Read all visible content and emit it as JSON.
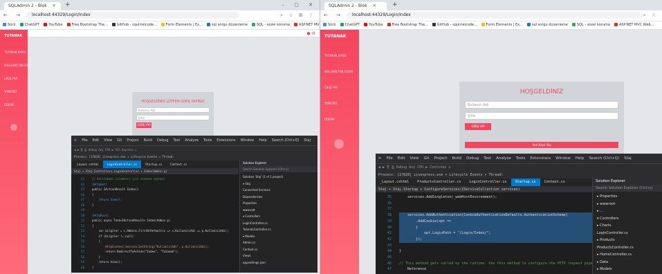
{
  "left": {
    "browser": {
      "tab_title": "SQLAdmin 2 - Blok",
      "new_tab": "+",
      "window_controls": "– ▢ ✕",
      "nav_icons": "← → ⟳ ⌂",
      "url": "localhost:44329/Login/Index",
      "addr_icons": "⌕ ☆ ⊞ ⋮",
      "bookmarks": [
        {
          "label": "Sürü",
          "color": "#4285f4"
        },
        {
          "label": "ChatGPT",
          "color": "#10a37f"
        },
        {
          "label": "YouTube",
          "color": "#ff0000"
        },
        {
          "label": "Free Bootstrap The...",
          "color": "#d93025"
        },
        {
          "label": "GitHub - squirrelcode...",
          "color": "#333333"
        },
        {
          "label": "Form Elements | Ex...",
          "color": "#fbbc04"
        },
        {
          "label": "sql sorgu düzenleme",
          "color": "#1a73e8"
        },
        {
          "label": "SQL - sozel koruma",
          "color": "#34a853"
        },
        {
          "label": "ASP.NET MVC Web...",
          "color": "#d93025"
        }
      ]
    },
    "app": {
      "brand": "TUTANAK",
      "side_items": [
        "TUTANAK KAYDI",
        "KULLANICI BİLGİLERİ",
        "ÇIKIŞ YAP",
        "YÖNETİCİ",
        "ÖDEME"
      ],
      "card_title": "HOŞGELDİNİZ LÜTFEN GİRİŞ YAPINIZ",
      "username_placeholder": "Kullanıcı Adı",
      "password_placeholder": "Şifre",
      "login_button": "GİRİŞ YAP"
    },
    "vs": {
      "menu": [
        "File",
        "Edit",
        "View",
        "Git",
        "Project",
        "Build",
        "Debug",
        "Test",
        "Analyze",
        "Tools",
        "Extensions",
        "Window",
        "Help",
        "Search (Ctrl+Q)",
        "Staj"
      ],
      "tool": "◀ ▶  ⎘ ⎙  Debug  Any CPU  ▶ IIS Express  ↻",
      "process": "Process: [17828] iisexpress.exe   ▾ Lifecycle Events ▾ Thread:",
      "tabs": [
        "_Layout.cshtml",
        "LoginController.cs",
        "Startup.cs",
        "Context.cs"
      ],
      "active_tab": "LoginController.cs",
      "crumb": "Staj   ▾  Staj.Controllers.LoginController   ▾  Index(Admin p)",
      "lines": [
        "43",
        "44",
        "45",
        "46",
        "47",
        "48",
        "49",
        "50",
        "51",
        "52",
        "53",
        "54",
        "55",
        "56",
        "57",
        "58",
        "59",
        "60"
      ],
      "code": [
        {
          "cls": "cm",
          "text": "// Veritabanı işlemleri için context nesnesi"
        },
        {
          "cls": "kw",
          "text": "[HttpGet]"
        },
        {
          "cls": "",
          "text": "public IActionResult Index()"
        },
        {
          "cls": "",
          "text": "{"
        },
        {
          "cls": "kw",
          "text": "    return View();"
        },
        {
          "cls": "",
          "text": "}"
        },
        {
          "cls": "",
          "text": ""
        },
        {
          "cls": "kw",
          "text": "[HttpPost]"
        },
        {
          "cls": "",
          "text": "public async Task<IActionResult> Index(Admin p)"
        },
        {
          "cls": "",
          "text": "{"
        },
        {
          "cls": "",
          "text": "    var bilgiler = c.Admins.FirstOrDefault(x => x.KullaniciAdi == p.KullaniciAdi);"
        },
        {
          "cls": "",
          "text": "    if (bilgiler != null)"
        },
        {
          "cls": "",
          "text": "    {"
        },
        {
          "cls": "st",
          "text": "        HttpContext.Session.SetString(\"KullaniciAdi\", p.KullaniciAdi);"
        },
        {
          "cls": "",
          "text": "        return RedirectToAction(\"Index\", \"Tutanak\");"
        },
        {
          "cls": "",
          "text": "    }"
        },
        {
          "cls": "",
          "text": "    return View();"
        },
        {
          "cls": "",
          "text": "}"
        }
      ],
      "se_title": "Solution Explorer",
      "se_search": "Search Solution Explorer (Ctrl+ş)",
      "se_items": [
        "Solution 'Staj' (1 of 1 project)",
        "▾ Staj",
        "  Connected Services",
        "  Dependencies",
        "  Properties",
        "  wwwroot",
        "  ▾ Controllers",
        "    LoginController.cs",
        "    TutanakController.cs",
        "  ▾ Models",
        "    Admin.cs",
        "    Context.cs",
        "  Views",
        "  appsettings.json"
      ]
    }
  },
  "right": {
    "browser": {
      "tab_title": "SQLAdmin 2 - Blok",
      "new_tab": "+",
      "nav_icons": "← → ⟳ ⌂",
      "url": "localhost:44329/Login/Index",
      "addr_icons": "⌕ ☆",
      "bookmarks": [
        {
          "label": "Sürü",
          "color": "#4285f4"
        },
        {
          "label": "ChatGPT",
          "color": "#10a37f"
        },
        {
          "label": "YouTube",
          "color": "#ff0000"
        },
        {
          "label": "Free Bootstrap The...",
          "color": "#d93025"
        },
        {
          "label": "GitHub - squirrelcode...",
          "color": "#333333"
        },
        {
          "label": "Form Elements | Ex...",
          "color": "#fbbc04"
        },
        {
          "label": "sql sorgu düzenleme",
          "color": "#1a73e8"
        },
        {
          "label": "SQL - sozel koruma",
          "color": "#34a853"
        },
        {
          "label": "ASP.NET MVC Web...",
          "color": "#d93025"
        }
      ]
    },
    "app": {
      "brand": "TUTANAK",
      "side_items": [
        "TUTANAK KAYDI",
        "KULLANICI BİLGİLERİ",
        "ÇIKIŞ YAP",
        "YÖNETİCİ",
        "ÖDEME"
      ],
      "card_title": "HOŞGELDİNİZ",
      "username_placeholder": "Kullanıcı Adı",
      "password_placeholder": "Şifre",
      "login_button": "GİRİŞ YAP",
      "wide_button": "Yeni Kayıt Yap"
    },
    "vs": {
      "menu": [
        "File",
        "Edit",
        "View",
        "Git",
        "Project",
        "Build",
        "Debug",
        "Test",
        "Analyze",
        "Tools",
        "Extensions",
        "Window",
        "Help",
        "Search (Ctrl+Q)",
        "Staj"
      ],
      "tool": "◀ ▶  ⎘ ⎙  Debug  Any CPU  ▶ Continue  ↻",
      "process": "Process: [17828] iisexpress.exe   ▾ Lifecycle Events ▾ Thread:",
      "tabs": [
        "_Layout.cshtml",
        "ProductsController.cs",
        "LoginController.cs",
        "Startup.cs",
        "Context.cs"
      ],
      "active_tab": "Startup.cs",
      "crumb": "Staj   ▾  Staj.Startup   ▾  ConfigureServices(IServiceCollection services)",
      "lines": [
        "35",
        "36",
        "37",
        "38",
        "39",
        "40",
        "41",
        "42",
        "43",
        "44",
        "45",
        "46",
        "47"
      ],
      "code": [
        {
          "cls": "",
          "text": "    services.AddSingleton(_webHostEnvironment);"
        },
        {
          "cls": "",
          "text": ""
        },
        {
          "cls": "",
          "text": ""
        },
        {
          "cls": "sel",
          "text": "    services.AddAuthentication(CookieAuthenticationDefaults.AuthenticationScheme)"
        },
        {
          "cls": "sel",
          "text": "        .AddCookie(opt =>"
        },
        {
          "cls": "sel",
          "text": "        {"
        },
        {
          "cls": "sel",
          "text": "            opt.LoginPath = \"/Login/Index/\";"
        },
        {
          "cls": "sel",
          "text": "        });"
        },
        {
          "cls": "",
          "text": ""
        },
        {
          "cls": "",
          "text": "}"
        },
        {
          "cls": "",
          "text": ""
        },
        {
          "cls": "cm",
          "text": "// This method gets called by the runtime. Use this method to configure the HTTP request pipeline."
        },
        {
          "cls": "",
          "text": "    Reference"
        }
      ],
      "se_title": "Solution Explorer",
      "se_search": "Search Solution Explorer (Ctrl+ş)",
      "se_items": [
        "▸ Properties",
        "▸ wwwroot",
        "▸ ...",
        "▾ Controllers",
        "  ▸ Charts",
        "     LoginController.cs",
        "  ▸ Products",
        "     ProductsController.cs",
        "  ▸ HomeController.cs",
        "▸ Data",
        "▸ Models"
      ]
    }
  }
}
